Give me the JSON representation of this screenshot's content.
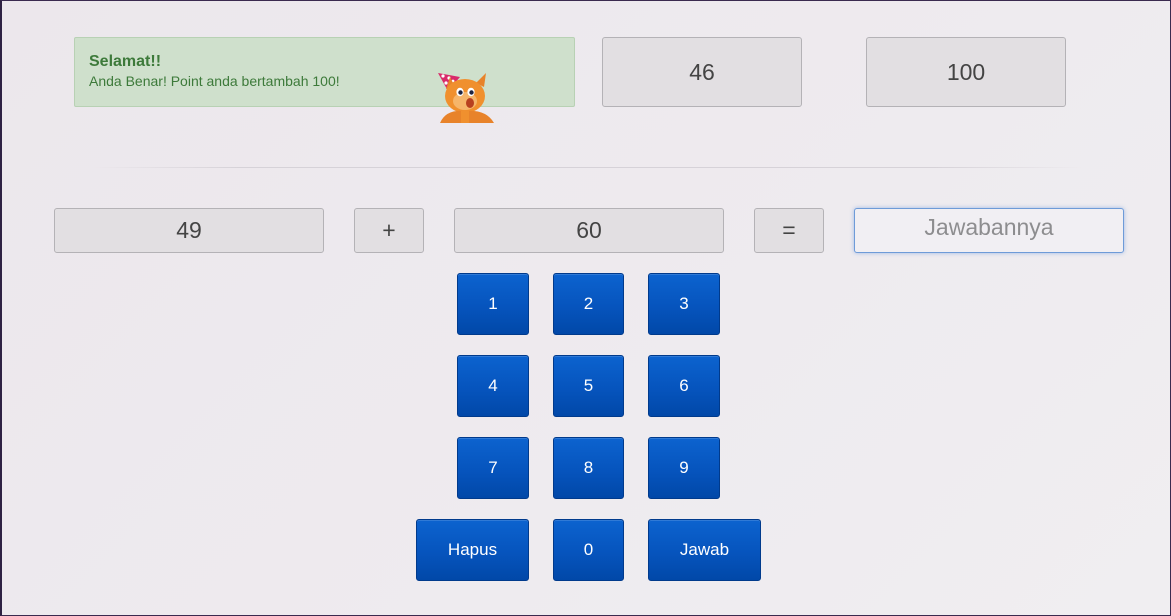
{
  "alert": {
    "title": "Selamat!!",
    "message": "Anda Benar! Point anda bertambah 100!",
    "color": "#3d7a3a",
    "background": "#cfe0cc"
  },
  "scores": {
    "left": "46",
    "right": "100"
  },
  "equation": {
    "operand1": "49",
    "operator": "+",
    "operand2": "60",
    "equals": "=",
    "answer_placeholder": "Jawabannya",
    "answer_value": ""
  },
  "keypad": {
    "k1": "1",
    "k2": "2",
    "k3": "3",
    "k4": "4",
    "k5": "5",
    "k6": "6",
    "k7": "7",
    "k8": "8",
    "k9": "9",
    "k0": "0",
    "clear": "Hapus",
    "submit": "Jawab",
    "color": "#0654bd"
  },
  "icons": {
    "mascot": "party-hat-cat-icon"
  }
}
